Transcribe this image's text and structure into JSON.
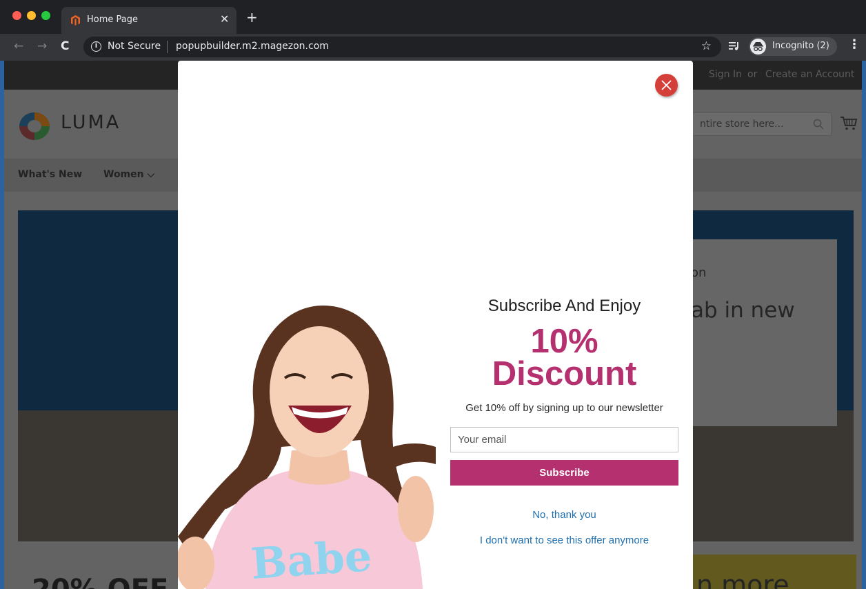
{
  "browser": {
    "tab_title": "Home Page",
    "tab_close_glyph": "✕",
    "new_tab_glyph": "+",
    "back_glyph": "←",
    "forward_glyph": "→",
    "reload_glyph": "C",
    "security_label": "Not Secure",
    "url": "popupbuilder.m2.magezon.com",
    "bookmark_glyph": "☆",
    "profile_label": "Incognito (2)",
    "menu_glyph": "⋮"
  },
  "store": {
    "topbar": {
      "sign_in": "Sign In",
      "or": "or",
      "create_account": "Create an Account"
    },
    "logo_text": "LUMA",
    "search_placeholder": "ntire store here...",
    "nav": [
      {
        "label": "What's New"
      },
      {
        "label": "Women ⌵"
      }
    ],
    "hero": {
      "small_text": "on",
      "big_text": "ab in new"
    },
    "promo_left_text": "20% OFF",
    "promo_right_text": "n more"
  },
  "popup": {
    "heading": "Subscribe And Enjoy",
    "discount_line1": "10%",
    "discount_line2": "Discount",
    "subtext": "Get 10% off by signing up to our newsletter",
    "email_placeholder": "Your email",
    "email_value": "",
    "subscribe_label": "Subscribe",
    "decline_label": "No, thank you",
    "never_label": "I don't want to see this offer anymore",
    "shirt_text": "Babe"
  },
  "colors": {
    "accent": "#b5306f",
    "link": "#1f6fae",
    "close_button": "#d43f3a"
  }
}
